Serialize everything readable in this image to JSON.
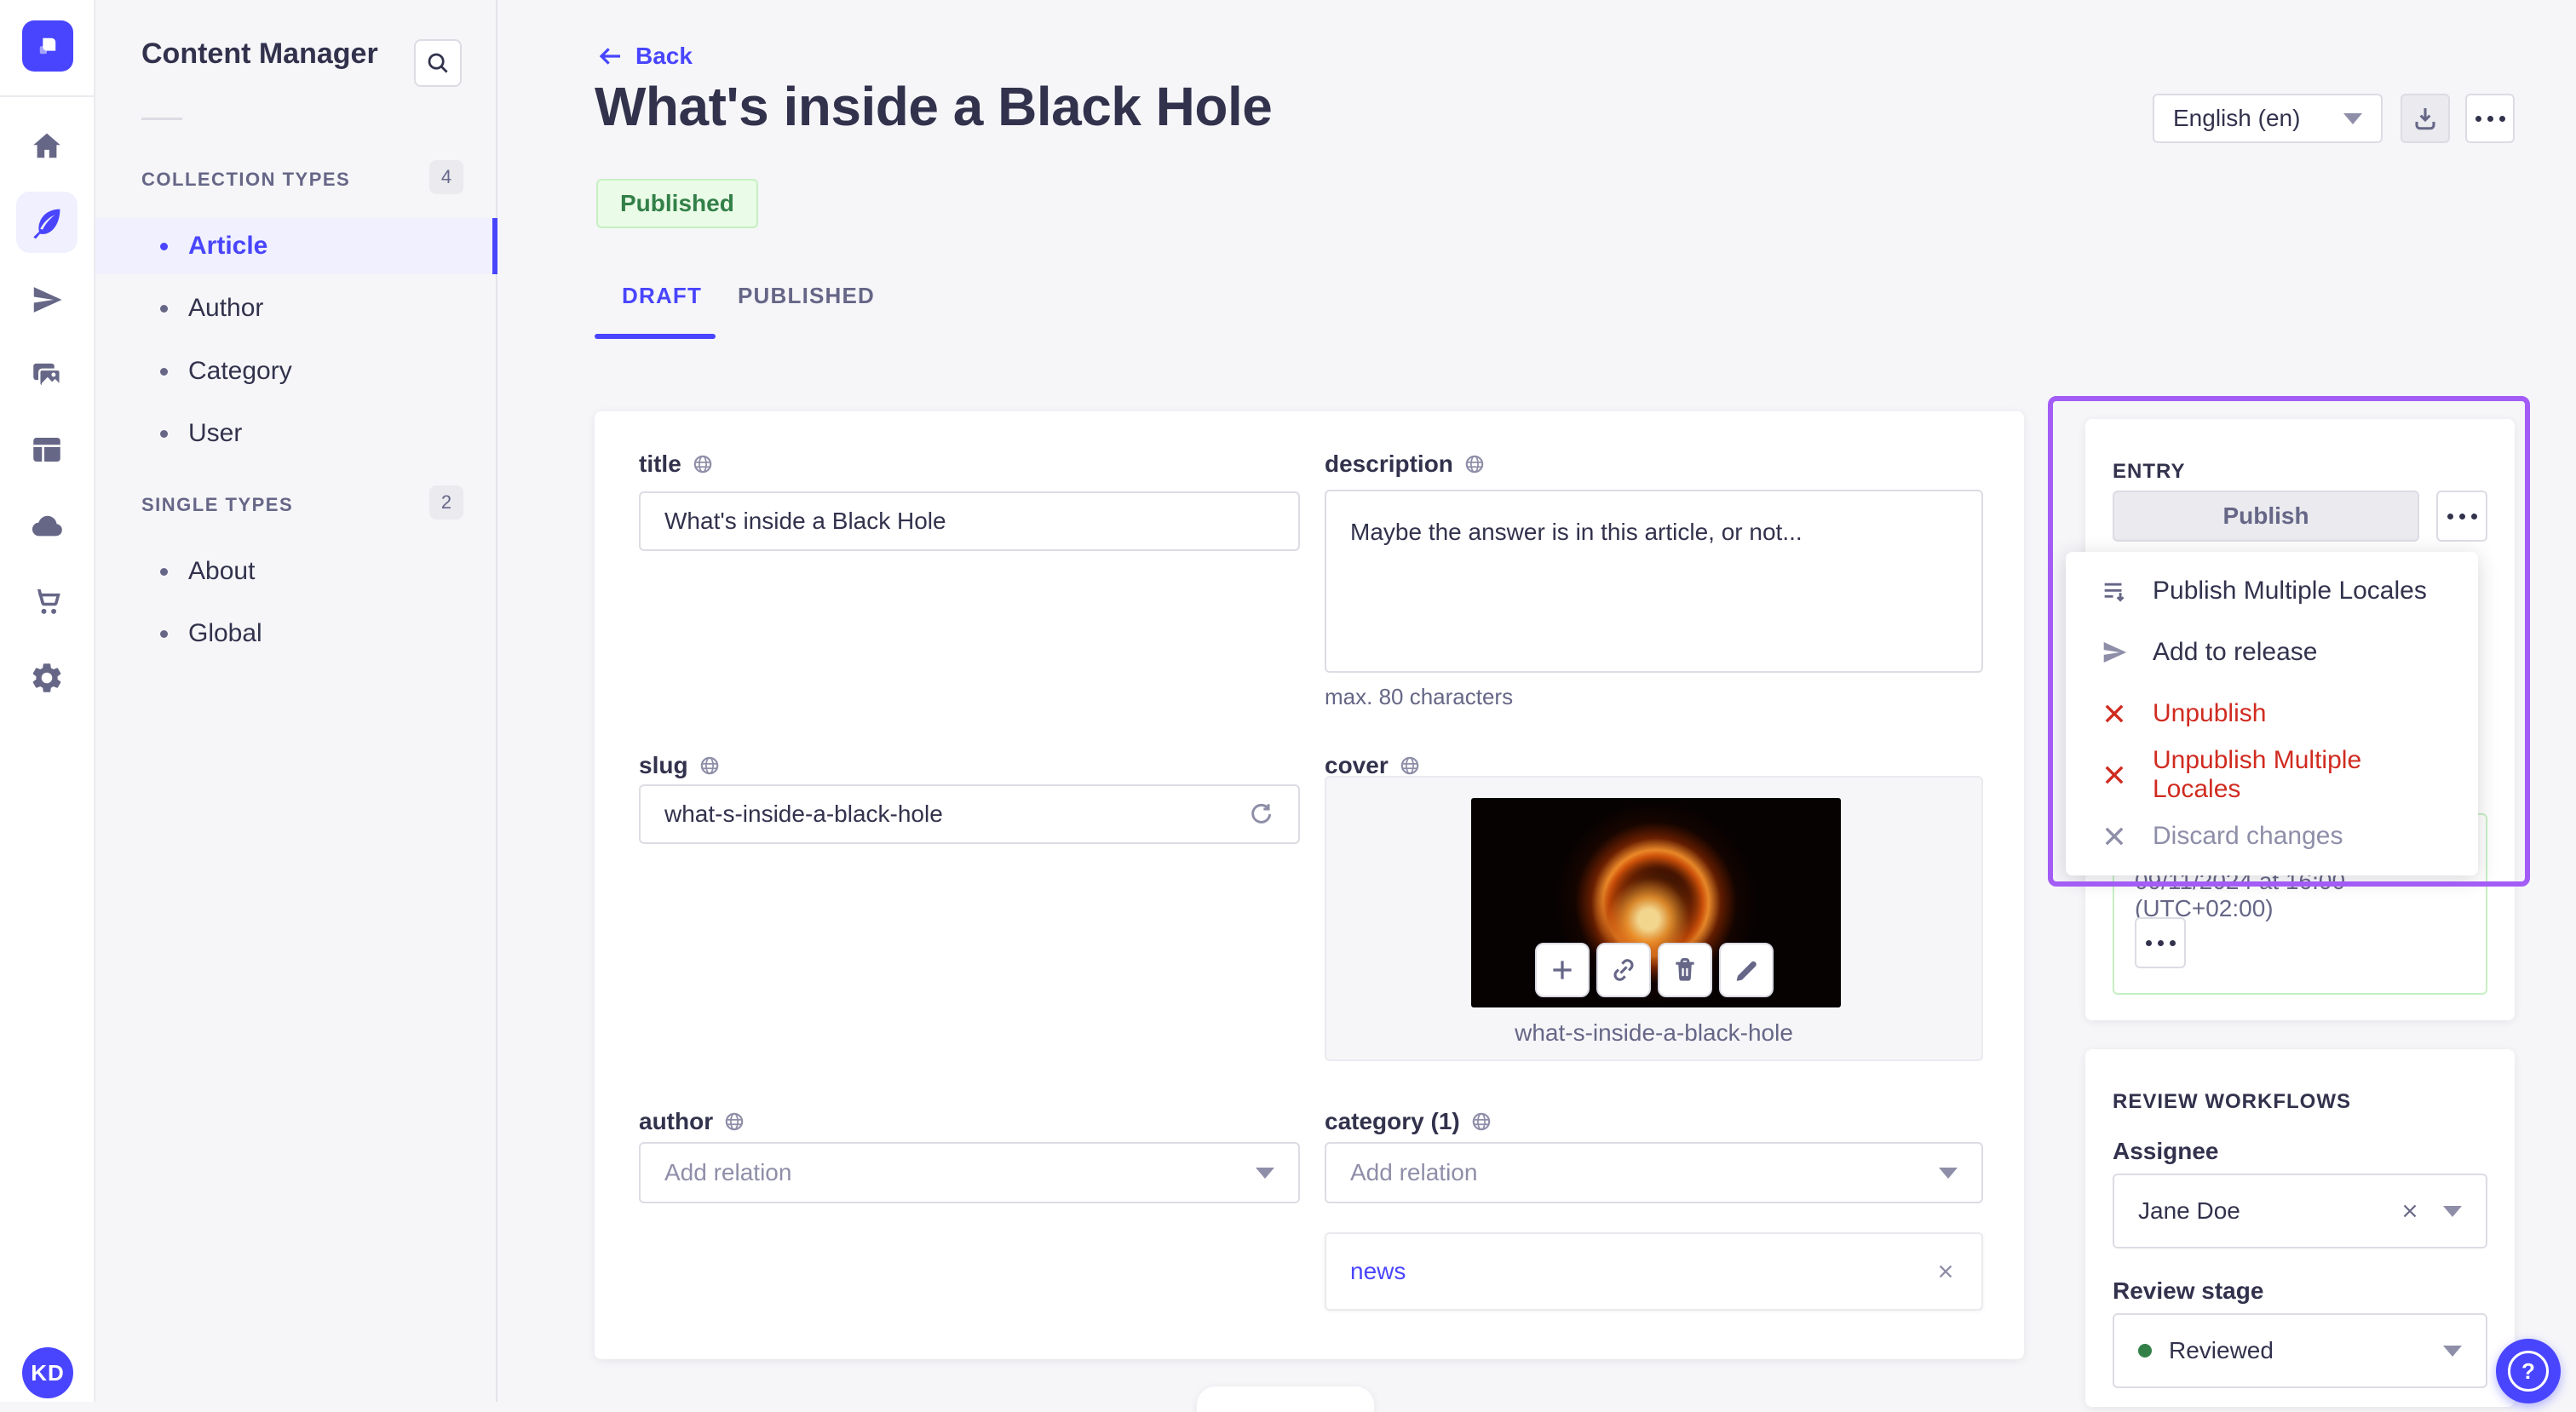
{
  "colors": {
    "primary": "#4945ff",
    "primary_bg": "#f0f0fe",
    "success_text": "#328048",
    "success_bg": "#eafbe7",
    "success_border": "#c6f0c2",
    "danger": "#d02b20",
    "highlight_overlay": "#a35cf5",
    "text": "#32324d",
    "subtext": "#666687",
    "muted": "#8e8ea9"
  },
  "rail": {
    "user_initials": "KD"
  },
  "sidebar": {
    "title": "Content Manager",
    "sections": [
      {
        "label": "COLLECTION TYPES",
        "count": "4",
        "items": [
          {
            "label": "Article"
          },
          {
            "label": "Author"
          },
          {
            "label": "Category"
          },
          {
            "label": "User"
          }
        ]
      },
      {
        "label": "SINGLE TYPES",
        "count": "2",
        "items": [
          {
            "label": "About"
          },
          {
            "label": "Global"
          }
        ]
      }
    ]
  },
  "header": {
    "back": "Back",
    "title": "What's inside a Black Hole",
    "status": "Published",
    "locale": "English (en)"
  },
  "tabs": {
    "draft": "DRAFT",
    "published": "PUBLISHED"
  },
  "form": {
    "title": {
      "label": "title",
      "value": "What's inside a Black Hole"
    },
    "description": {
      "label": "description",
      "value": "Maybe the answer is in this article, or not...",
      "helper": "max. 80 characters"
    },
    "slug": {
      "label": "slug",
      "value": "what-s-inside-a-black-hole"
    },
    "cover": {
      "label": "cover",
      "caption": "what-s-inside-a-black-hole"
    },
    "author": {
      "label": "author",
      "placeholder": "Add relation"
    },
    "category": {
      "label": "category (1)",
      "placeholder": "Add relation",
      "relation": "news"
    }
  },
  "entry": {
    "heading": "ENTRY",
    "publish_label": "Publish",
    "menu": [
      {
        "label": "Publish Multiple Locales",
        "tone": "default"
      },
      {
        "label": "Add to release",
        "tone": "default"
      },
      {
        "label": "Unpublish",
        "tone": "danger"
      },
      {
        "label": "Unpublish Multiple Locales",
        "tone": "danger"
      },
      {
        "label": "Discard changes",
        "tone": "disabled"
      }
    ],
    "scheduled_date": "09/11/2024 at 16:00 (UTC+02:00)"
  },
  "review": {
    "heading": "REVIEW WORKFLOWS",
    "assignee_label": "Assignee",
    "assignee_value": "Jane Doe",
    "stage_label": "Review stage",
    "stage_value": "Reviewed"
  }
}
